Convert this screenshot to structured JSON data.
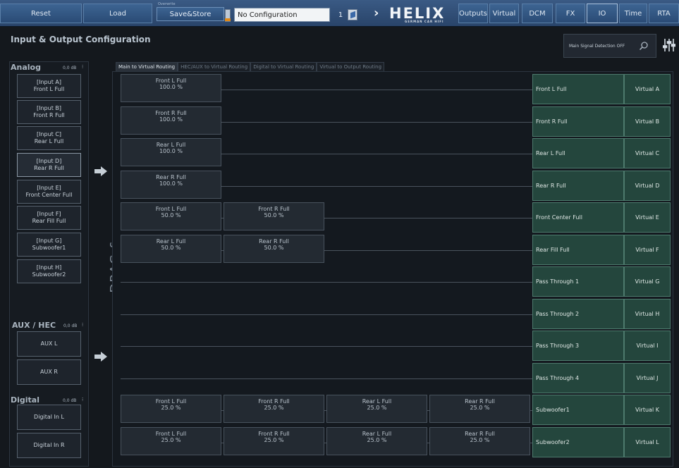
{
  "toolbar": {
    "reset": "Reset",
    "load": "Load",
    "overwrite_label": "Overwrite",
    "save_store": "Save&Store",
    "configuration": "No Configuration",
    "config_number": "1",
    "tabs": [
      "Outputs",
      "Virtual",
      "DCM",
      "FX",
      "IO",
      "Time",
      "RTA"
    ]
  },
  "logo": {
    "text": "HELIX",
    "subtitle": "GERMAN CAR HIFI"
  },
  "page": {
    "title": "Input & Output Configuration",
    "main_signal_detection": "Main Signal Detection OFF"
  },
  "sections": {
    "analog": {
      "title": "Analog",
      "db": "0,0 dB"
    },
    "aux": {
      "title": "AUX / HEC",
      "db": "0,0 dB"
    },
    "digital": {
      "title": "Digital",
      "db": "0,0 dB"
    }
  },
  "inputs": {
    "analog": [
      {
        "id": "[Input A]",
        "name": "Front L Full"
      },
      {
        "id": "[Input B]",
        "name": "Front R Full"
      },
      {
        "id": "[Input C]",
        "name": "Rear L Full"
      },
      {
        "id": "[Input D]",
        "name": "Rear R Full"
      },
      {
        "id": "[Input E]",
        "name": "Front Center Full"
      },
      {
        "id": "[Input F]",
        "name": "Rear Fill Full"
      },
      {
        "id": "[Input G]",
        "name": "Subwoofer1"
      },
      {
        "id": "[Input H]",
        "name": "Subwoofer2"
      }
    ],
    "aux": [
      "AUX L",
      "AUX R"
    ],
    "digital": [
      "Digital In L",
      "Digital In R"
    ]
  },
  "drag_drop": "DRAG & DROP",
  "routing_tabs": [
    "Main to Virtual Routing",
    "HEC/AUX to Virtual Routing",
    "Digital to Virtual Routing",
    "Virtual to Output Routing"
  ],
  "rows": [
    {
      "sources": [
        {
          "name": "Front L Full",
          "pct": "100.0 %"
        }
      ],
      "dest": "Front L Full",
      "virtual": "Virtual A"
    },
    {
      "sources": [
        {
          "name": "Front R Full",
          "pct": "100.0 %"
        }
      ],
      "dest": "Front R Full",
      "virtual": "Virtual B"
    },
    {
      "sources": [
        {
          "name": "Rear L Full",
          "pct": "100.0 %"
        }
      ],
      "dest": "Rear L Full",
      "virtual": "Virtual C"
    },
    {
      "sources": [
        {
          "name": "Rear R Full",
          "pct": "100.0 %"
        }
      ],
      "dest": "Rear R Full",
      "virtual": "Virtual D"
    },
    {
      "sources": [
        {
          "name": "Front L Full",
          "pct": "50.0 %"
        },
        {
          "name": "Front R Full",
          "pct": "50.0 %"
        }
      ],
      "dest": "Front Center Full",
      "virtual": "Virtual E"
    },
    {
      "sources": [
        {
          "name": "Rear L Full",
          "pct": "50.0 %"
        },
        {
          "name": "Rear R Full",
          "pct": "50.0 %"
        }
      ],
      "dest": "Rear Fill Full",
      "virtual": "Virtual F"
    },
    {
      "sources": [],
      "dest": "Pass Through 1",
      "virtual": "Virtual G"
    },
    {
      "sources": [],
      "dest": "Pass Through 2",
      "virtual": "Virtual H"
    },
    {
      "sources": [],
      "dest": "Pass Through 3",
      "virtual": "Virtual I"
    },
    {
      "sources": [],
      "dest": "Pass Through 4",
      "virtual": "Virtual J"
    },
    {
      "sources": [
        {
          "name": "Front L Full",
          "pct": "25.0 %"
        },
        {
          "name": "Front R Full",
          "pct": "25.0 %"
        },
        {
          "name": "Rear L Full",
          "pct": "25.0 %"
        },
        {
          "name": "Rear R Full",
          "pct": "25.0 %"
        }
      ],
      "dest": "Subwoofer1",
      "virtual": "Virtual K"
    },
    {
      "sources": [
        {
          "name": "Front L Full",
          "pct": "25.0 %"
        },
        {
          "name": "Front R Full",
          "pct": "25.0 %"
        },
        {
          "name": "Rear L Full",
          "pct": "25.0 %"
        },
        {
          "name": "Rear R Full",
          "pct": "25.0 %"
        }
      ],
      "dest": "Subwoofer2",
      "virtual": "Virtual L"
    }
  ]
}
